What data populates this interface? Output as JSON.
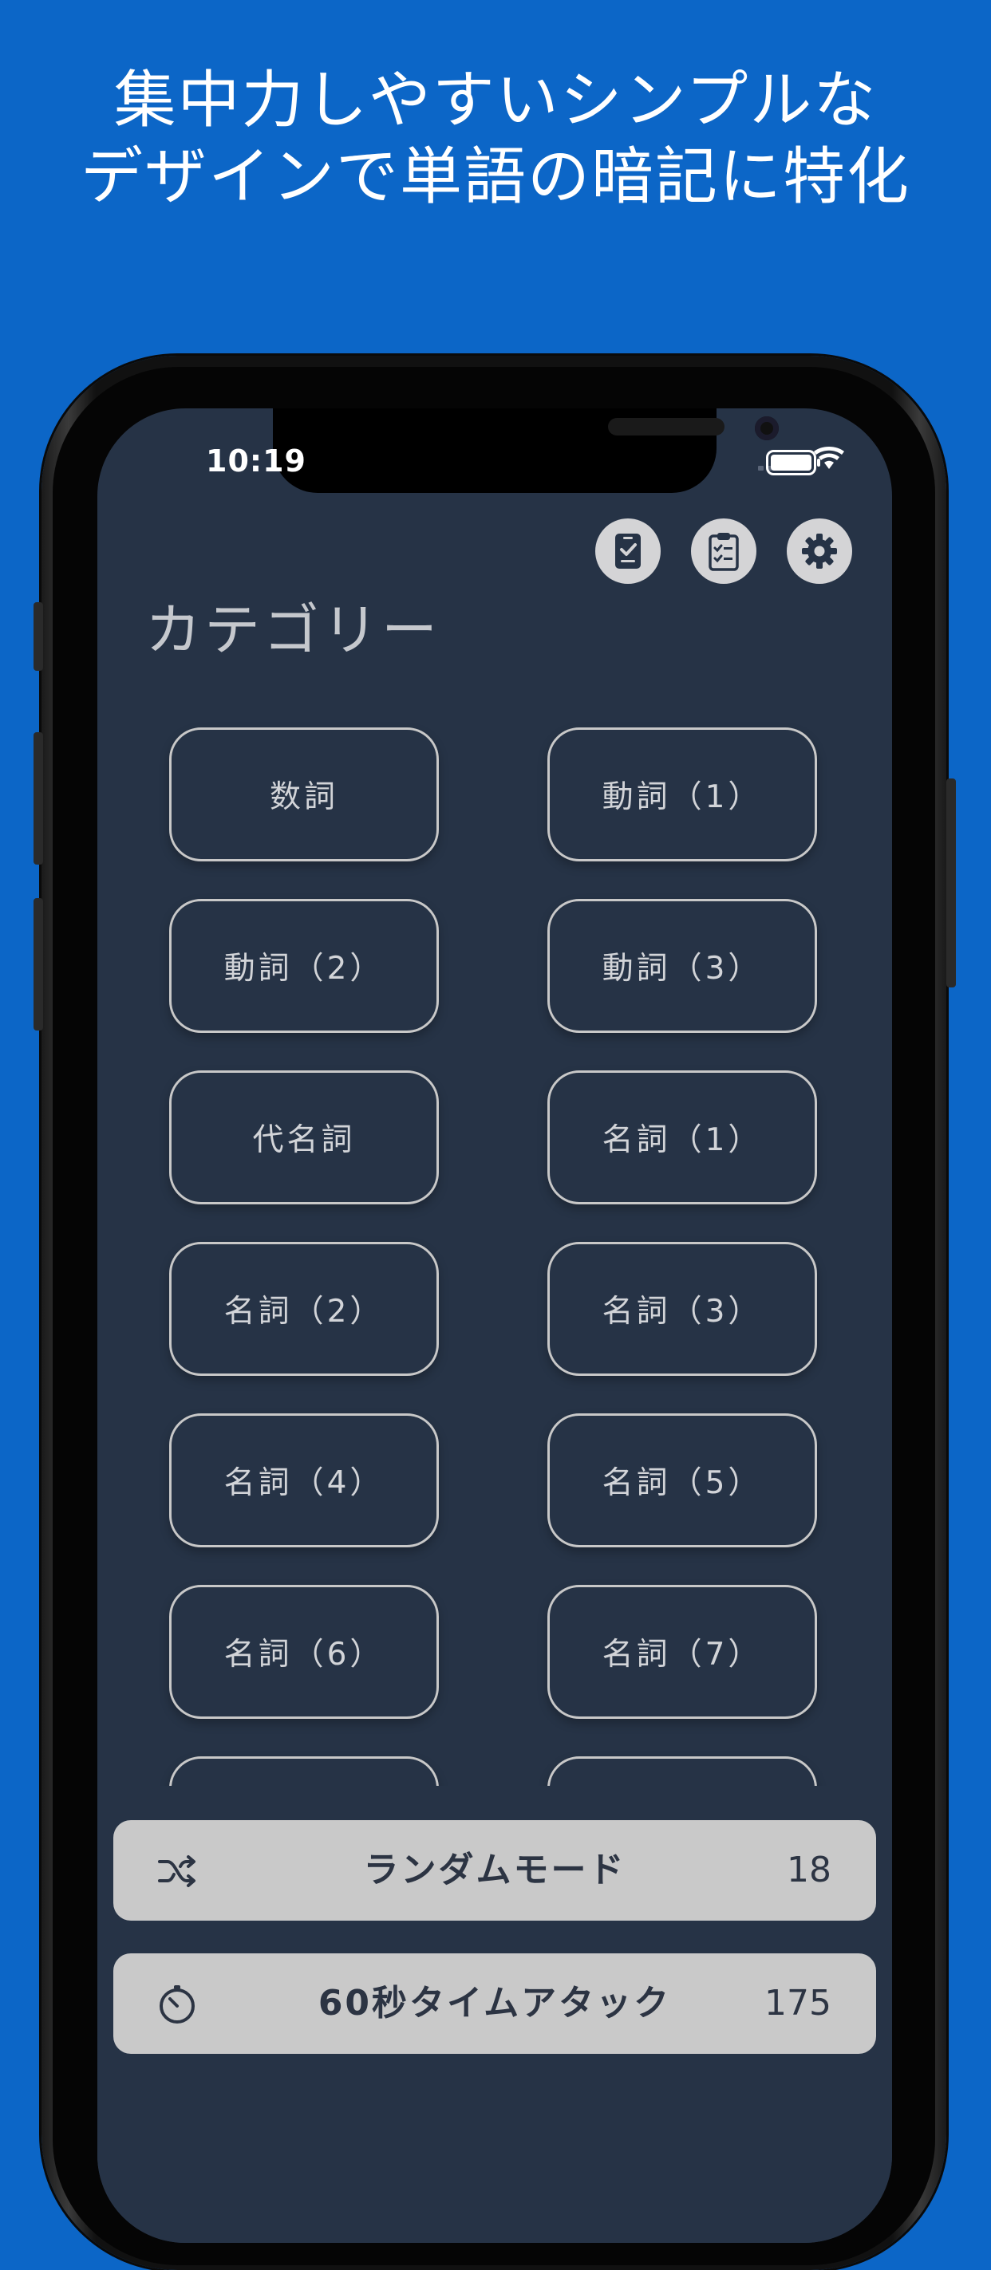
{
  "headline": {
    "line1": "集中力しやすいシンプルな",
    "line2": "デザインで単語の暗記に特化"
  },
  "status_bar": {
    "time": "10:19"
  },
  "toolbar": {
    "icons": [
      "id-badge-check-icon",
      "clipboard-check-icon",
      "gear-icon"
    ]
  },
  "page_title": "カテゴリー",
  "categories": [
    "数詞",
    "動詞（1）",
    "動詞（2）",
    "動詞（3）",
    "代名詞",
    "名詞（1）",
    "名詞（2）",
    "名詞（3）",
    "名詞（4）",
    "名詞（5）",
    "名詞（6）",
    "名詞（7）"
  ],
  "modes": {
    "random": {
      "label": "ランダムモード",
      "count": "18",
      "icon": "shuffle-icon"
    },
    "time_attack": {
      "label": "60秒タイムアタック",
      "count": "175",
      "icon": "stopwatch-icon"
    }
  },
  "colors": {
    "background": "#0c66c7",
    "screen": "#263346",
    "button_border": "#c8c8c8",
    "mode_bar": "#c9c9c9"
  }
}
